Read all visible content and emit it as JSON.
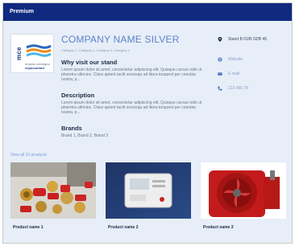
{
  "header": {
    "title": "Premium"
  },
  "company": {
    "logo_label": "mce",
    "logo_subtext": [
      "mostra convegno",
      "expocomfort"
    ],
    "name": "COMPANY NAME SILVER",
    "categories": "Category 1, Category 2, Category 3, Category 4"
  },
  "sections": {
    "why_title": "Why visit our stand",
    "why_text": "Lorem ipsum dolor sit amet, consectetur adipiscing elit. Quisque cursus odio ut pharetra ultricies. Class aptent taciti sociosqu ad litora torquent per conubia nostra, p...",
    "description_title": "Description",
    "description_text": "Lorem ipsum dolor sit amet, consectetur adipiscing elit. Quisque cursus odio ut pharetra ultricies. Class aptent taciti sociosqu ad litora torquent per conubia nostra, p...",
    "brands_title": "Brands",
    "brands_text": "Brand 1, Brand 2, Brand 3"
  },
  "contact": {
    "stand": "Stand B 01/B 02/B 45",
    "website": "Website",
    "email": "E-mail",
    "phone": "123 456 78"
  },
  "products": {
    "view_all": "View all 15 products",
    "items": [
      {
        "name": "Product name 1"
      },
      {
        "name": "Product name 2"
      },
      {
        "name": "Product name 3"
      }
    ]
  },
  "colors": {
    "header_bg": "#0f2a7f",
    "accent": "#5e84c9",
    "content_bg": "#e7eef8"
  }
}
